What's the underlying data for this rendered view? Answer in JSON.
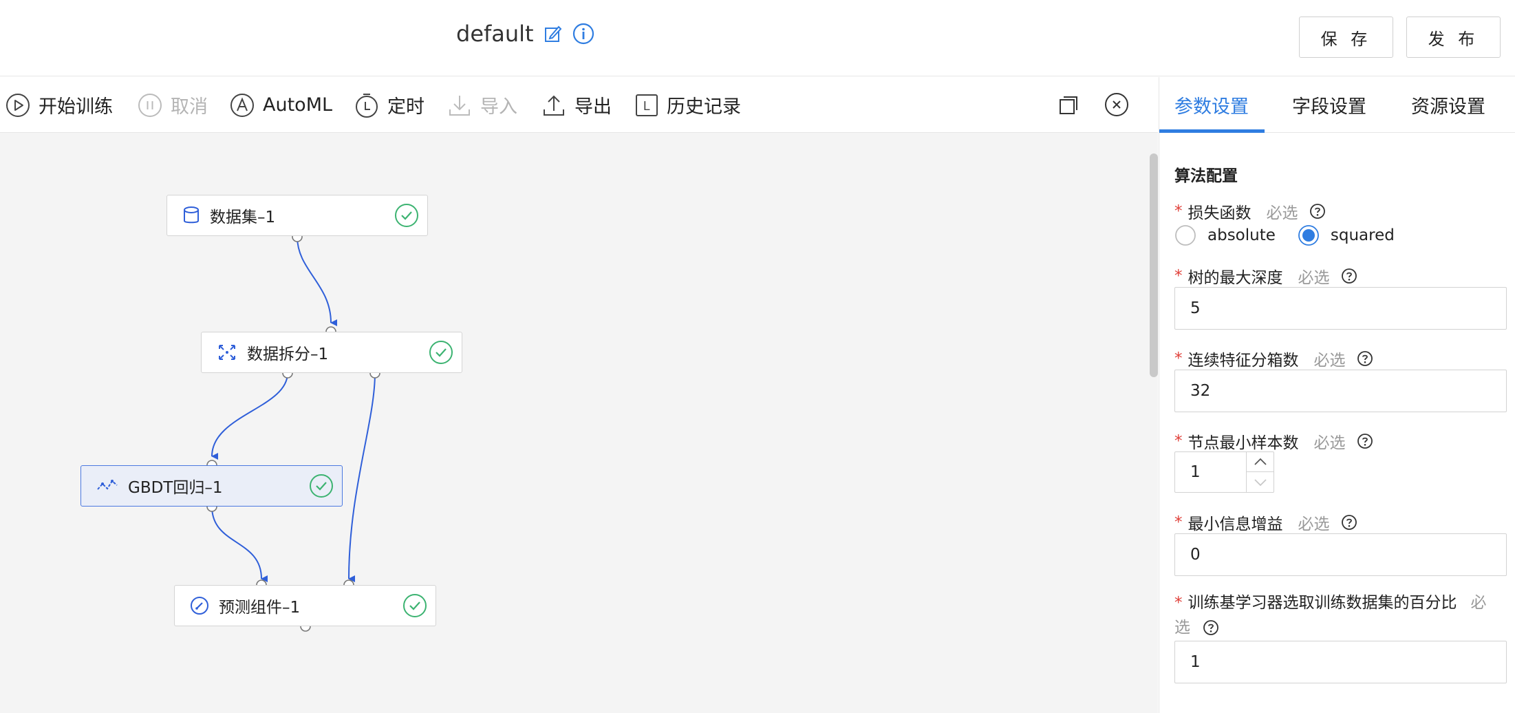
{
  "header": {
    "title": "default",
    "save_label": "保 存",
    "publish_label": "发 布"
  },
  "toolbar": {
    "start_training": "开始训练",
    "cancel": "取消",
    "automl": "AutoML",
    "schedule": "定时",
    "import": "导入",
    "export": "导出",
    "history": "历史记录",
    "history_icon_letter": "L"
  },
  "nodes": {
    "dataset": "数据集–1",
    "split": "数据拆分–1",
    "gbdt": "GBDT回归–1",
    "predict": "预测组件–1"
  },
  "panel": {
    "tabs": {
      "params": "参数设置",
      "fields": "字段设置",
      "resources": "资源设置"
    },
    "section_title": "算法配置",
    "required_mark": "*",
    "required_text": "必选",
    "fields": {
      "loss_function": {
        "label": "损失函数",
        "options": [
          "absolute",
          "squared"
        ],
        "selected": "squared"
      },
      "max_depth": {
        "label": "树的最大深度",
        "value": "5"
      },
      "bins": {
        "label": "连续特征分箱数",
        "value": "32"
      },
      "min_samples": {
        "label": "节点最小样本数",
        "value": "1"
      },
      "min_info_gain": {
        "label": "最小信息增益",
        "value": "0"
      },
      "subsample": {
        "label_line1": "训练基学习器选取训练数据集的百分比",
        "label_req_line1": "必",
        "label_req_line2": "选",
        "value": "1"
      }
    }
  },
  "colors": {
    "accent": "#2f7de1",
    "success": "#3cb371",
    "required": "#e0403a",
    "edge": "#2f5fd9"
  }
}
